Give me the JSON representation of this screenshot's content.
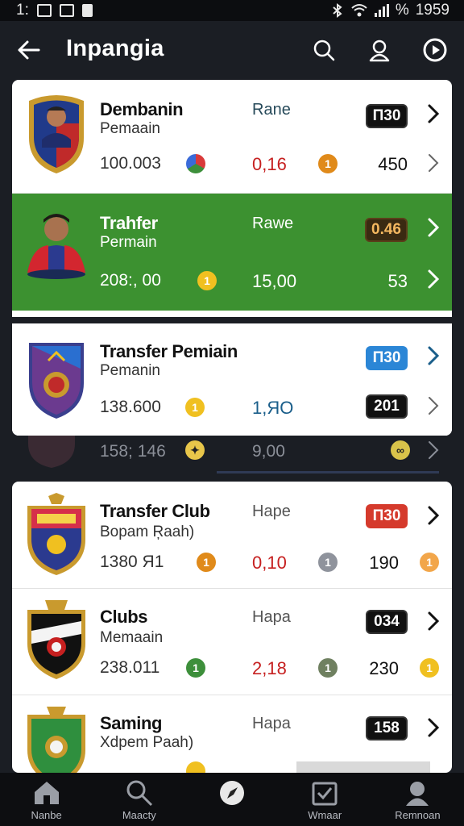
{
  "status_bar": {
    "time_left": "1:",
    "time_right": "1959",
    "battery": "%"
  },
  "app_bar": {
    "title": "Inpangia",
    "back_icon": "back-arrow-icon",
    "icons": [
      "search-icon",
      "user-search-icon",
      "play-icon"
    ]
  },
  "card1": {
    "rows": [
      {
        "name": "Dembanin",
        "sub": "Pemaain",
        "value1": "100.003",
        "label": "Rane",
        "value2": "0,16",
        "badge": "Π30",
        "value3": "450",
        "dot1_color": "#3d8f3b",
        "dot2_color": "#e08a1a"
      },
      {
        "name": "Trahfer",
        "sub": "Permain",
        "value1": "208:, 00",
        "label": "Rawe",
        "value2": "15,00",
        "badge": "0.46",
        "value3": "53",
        "dot1_color": "#f0c020"
      },
      {
        "name": "Transfer Pemiain",
        "sub": "Pemanin",
        "value1": "138.600",
        "label": "",
        "value2": "1,ЯO",
        "badge": "Π30",
        "value3": "201",
        "dot1_color": "#f0c020"
      }
    ]
  },
  "strip": {
    "value1": "158; 146",
    "value2": "9,00"
  },
  "card2": {
    "rows": [
      {
        "name": "Transfer Club",
        "sub": "Bopam Ŗaah)",
        "value1": "1380 Я1",
        "label": "Hape",
        "value2": "0,10",
        "badge": "Π30",
        "value3": "190",
        "dot1_color": "#e08a1a",
        "dot2_color": "#8f939c",
        "dot3_color": "#f2a64a"
      },
      {
        "name": "Clubs",
        "sub": "Memaain",
        "value1": "238.011",
        "label": "Hapa",
        "value2": "2,18",
        "badge": "034",
        "value3": "230",
        "dot1_color": "#3d8f3b",
        "dot2_color": "#6f8060",
        "dot3_color": "#f0c020"
      },
      {
        "name": "Saming",
        "sub": "Xdpem Paah)",
        "label": "Hapa",
        "badge": "158"
      }
    ]
  },
  "bottom_nav": {
    "items": [
      {
        "label": "Nanbe",
        "icon": "home-icon"
      },
      {
        "label": "Maacty",
        "icon": "search-icon"
      },
      {
        "label": "",
        "icon": "compass-icon"
      },
      {
        "label": "Wmaar",
        "icon": "checkbox-icon"
      },
      {
        "label": "Remnoan",
        "icon": "profile-icon"
      }
    ]
  },
  "colors": {
    "background": "#1b1e24",
    "card": "#ffffff",
    "highlight": "#3c9130",
    "value_red": "#c62020",
    "badge_blue": "#2b86d6",
    "badge_red": "#d53a2c"
  }
}
